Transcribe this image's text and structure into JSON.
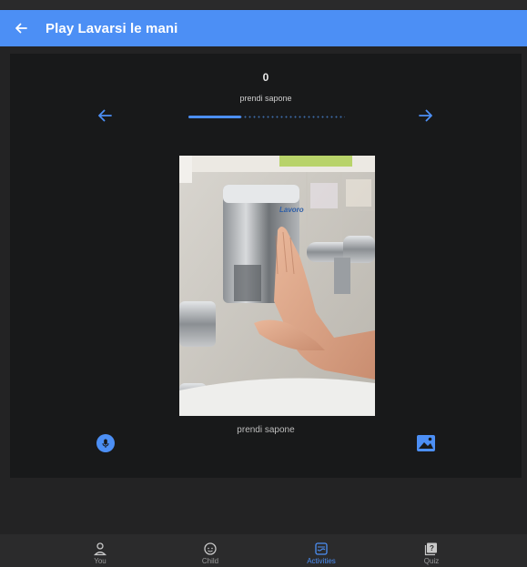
{
  "app_bar": {
    "title": "Play Lavarsi le mani",
    "background_color": "#4c8ff5",
    "back_icon": "arrow-left-icon"
  },
  "step": {
    "number": "0",
    "label": "prendi sapone",
    "caption": "prendi sapone",
    "progress_fraction": 0.34,
    "prev_icon": "arrow-left-icon",
    "next_icon": "arrow-right-icon",
    "image_subject": "child hand pressing a wall-mounted soap dispenser",
    "image_brand_text": "Lavoro"
  },
  "actions": {
    "record_icon": "microphone-icon",
    "image_icon": "image-icon"
  },
  "bottom_nav": {
    "items": [
      {
        "label": "You",
        "icon": "person-icon",
        "active": false
      },
      {
        "label": "Child",
        "icon": "child-face-icon",
        "active": false
      },
      {
        "label": "Activities",
        "icon": "activities-icon",
        "active": true
      },
      {
        "label": "Quiz",
        "icon": "quiz-icon",
        "active": false
      }
    ],
    "active_color": "#4c8ff5"
  }
}
